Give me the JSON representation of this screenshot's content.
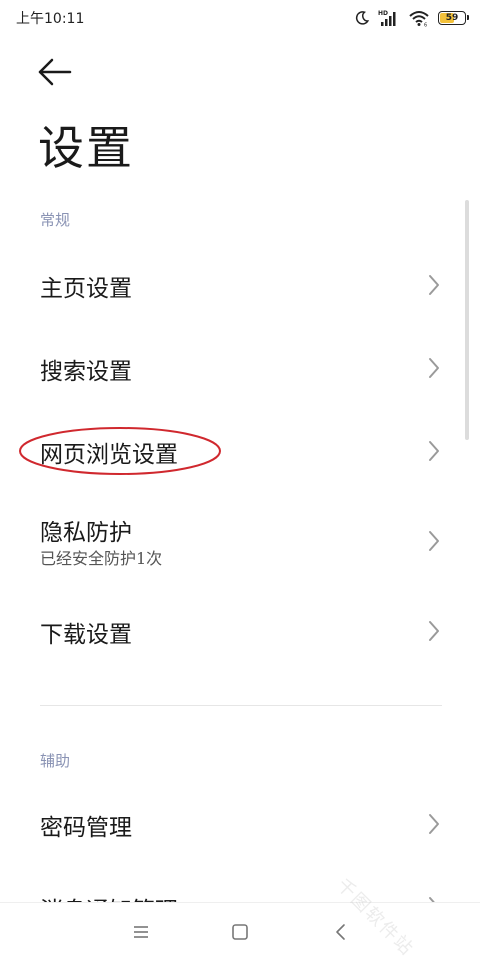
{
  "status_bar": {
    "time": "上午10:11",
    "battery_level": "59",
    "battery_fraction": 0.59,
    "icons": [
      "moon-icon",
      "signal-hd-icon",
      "wifi-icon",
      "battery-icon"
    ]
  },
  "header": {
    "back_icon": "arrow-left-icon",
    "title": "设置"
  },
  "sections": {
    "general": {
      "header": "常规",
      "items": [
        {
          "label": "主页设置"
        },
        {
          "label": "搜索设置"
        },
        {
          "label": "网页浏览设置",
          "highlighted": true
        },
        {
          "label": "隐私防护",
          "subtitle": "已经安全防护1次"
        },
        {
          "label": "下载设置"
        }
      ]
    },
    "assist": {
      "header": "辅助",
      "items": [
        {
          "label": "密码管理"
        },
        {
          "label": "消息通知管理"
        }
      ]
    }
  },
  "colors": {
    "section_header": "#8a93b4",
    "highlight_ring": "#d0282e",
    "battery_fill": "#f3c13a"
  },
  "nav_bar": {
    "icons": [
      "menu-icon",
      "home-square-icon",
      "back-chevron-icon"
    ]
  },
  "watermark": "千图软件站"
}
